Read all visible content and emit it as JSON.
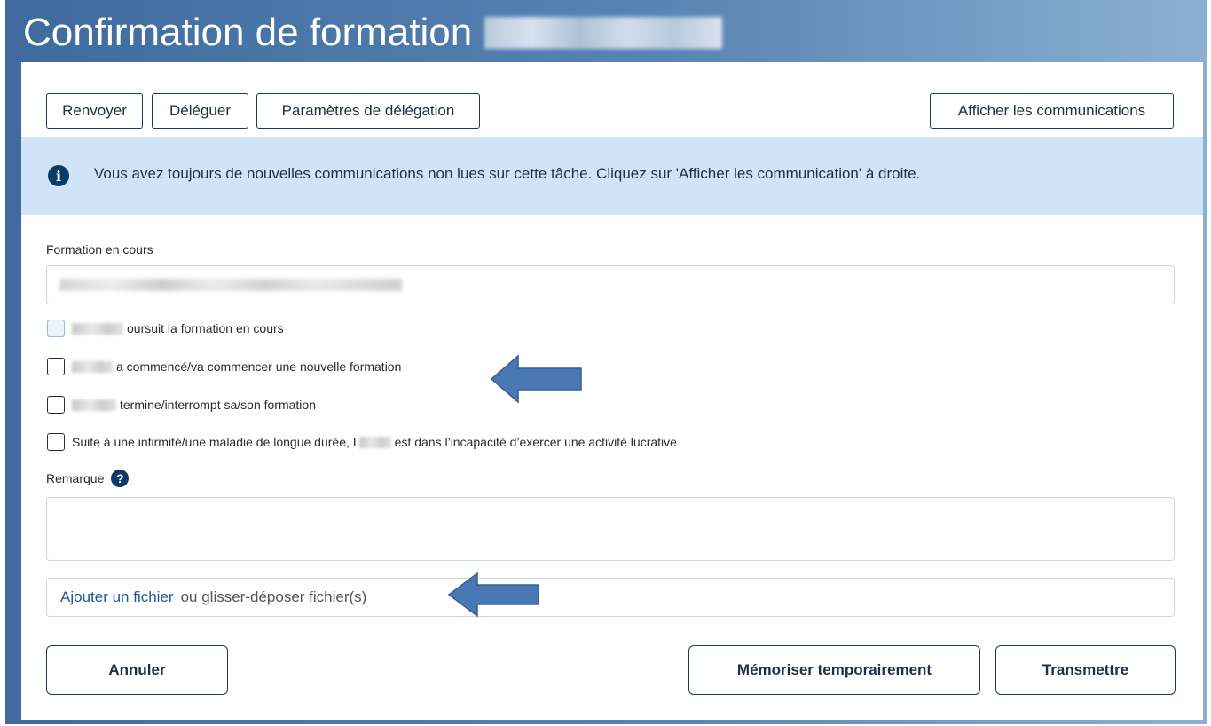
{
  "window": {
    "title": "Confirmation de formation"
  },
  "toolbar": {
    "resend_label": "Renvoyer",
    "delegate_label": "Déléguer",
    "delegation_settings_label": "Paramètres de délégation",
    "show_communications_label": "Afficher les communications"
  },
  "info_banner": {
    "icon": "info-icon",
    "text": "Vous avez toujours de nouvelles communications non lues sur cette tâche. Cliquez sur 'Afficher les communication' à droite."
  },
  "form": {
    "current_training_label": "Formation en cours",
    "checkboxes": [
      {
        "label": "oursuit la formation en cours",
        "checked": false
      },
      {
        "label": "a commencé/va commencer une nouvelle formation",
        "checked": false
      },
      {
        "label": "termine/interrompt sa/son formation",
        "checked": false
      },
      {
        "label_before": "Suite à une infirmité/une maladie de longue durée, I",
        "label_after": "est dans l’incapacité d’exercer une activité lucrative",
        "checked": false
      }
    ],
    "remark_label": "Remarque",
    "remark_value": "",
    "file": {
      "link_label": "Ajouter un fichier",
      "hint": "ou glisser-déposer fichier(s)"
    }
  },
  "footer": {
    "cancel_label": "Annuler",
    "save_temp_label": "Mémoriser temporairement",
    "submit_label": "Transmettre"
  },
  "colors": {
    "header_gradient_start": "#3f6a9e",
    "header_gradient_end": "#8cb0d2",
    "banner_bg": "#cfe4f6",
    "icon_navy": "#0b3b66",
    "arrow_fill": "#4a78b4",
    "link": "#1d5a96"
  }
}
